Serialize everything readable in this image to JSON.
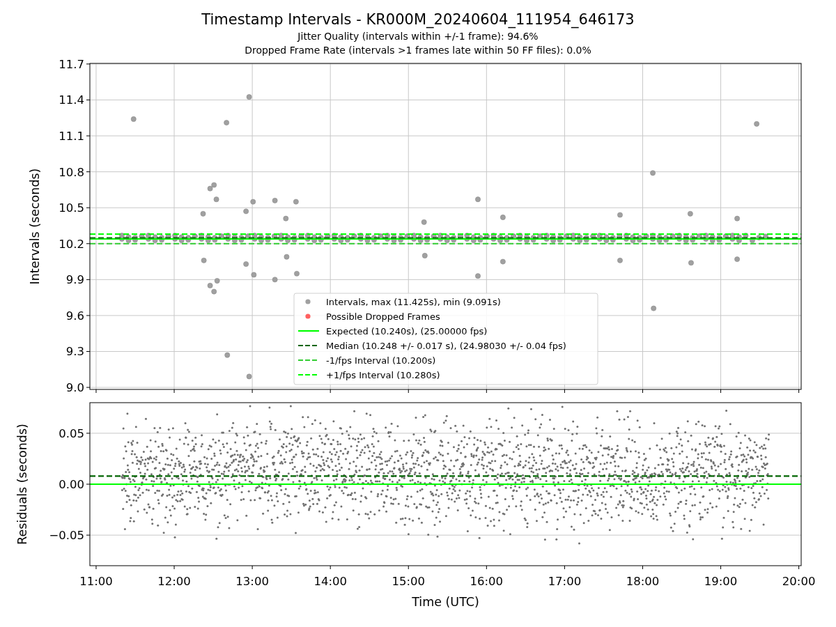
{
  "title": "Timestamp Intervals - KR000M_20240604_111954_646173",
  "subtitles": [
    "Jitter Quality (intervals within +/-1 frame): 94.6%",
    "Dropped Frame Rate (intervals >1 frames late within 50 FF files): 0.0%"
  ],
  "charts": [
    {
      "chart_data": {
        "type": "scatter",
        "ylabel": "Intervals (seconds)",
        "grid": true,
        "legend": "lower center",
        "xlim": [
          10.92,
          20.03
        ],
        "ylim": [
          8.983,
          11.705
        ],
        "yticks": [
          {
            "value": 9.0,
            "label": "9.0"
          },
          {
            "value": 9.3,
            "label": "9.3"
          },
          {
            "value": 9.6,
            "label": "9.6"
          },
          {
            "value": 9.9,
            "label": "9.9"
          },
          {
            "value": 10.2,
            "label": "10.2"
          },
          {
            "value": 10.5,
            "label": "10.5"
          },
          {
            "value": 10.8,
            "label": "10.8"
          },
          {
            "value": 11.1,
            "label": "11.1"
          },
          {
            "value": 11.4,
            "label": "11.4"
          },
          {
            "value": 11.7,
            "label": "11.7"
          }
        ],
        "series": [
          {
            "name": "Intervals, max (11.425s), min (9.091s)",
            "color": "#a0a0a0",
            "x": [
              11.48,
              12.67,
              12.96,
              19.46,
              18.13,
              12.46,
              12.51,
              12.54,
              12.37,
              12.92,
              13.01,
              13.29,
              13.56,
              13.43,
              15.2,
              15.89,
              16.21,
              17.71,
              18.61,
              19.21,
              12.38,
              12.46,
              12.51,
              12.55,
              12.92,
              13.02,
              13.29,
              13.44,
              13.57,
              15.21,
              15.89,
              16.21,
              17.71,
              18.62,
              19.21,
              18.14,
              12.68,
              12.96,
              11.33,
              11.415,
              11.5,
              11.585,
              11.67,
              11.755,
              11.84,
              11.925,
              12.01,
              12.095,
              12.18,
              12.265,
              12.35,
              12.435,
              12.52,
              12.605,
              12.69,
              12.775,
              12.86,
              12.945,
              13.03,
              13.115,
              13.2,
              13.285,
              13.37,
              13.455,
              13.54,
              13.625,
              13.71,
              13.795,
              13.88,
              13.965,
              14.05,
              14.135,
              14.22,
              14.305,
              14.39,
              14.475,
              14.56,
              14.645,
              14.73,
              14.815,
              14.9,
              14.985,
              15.07,
              15.155,
              15.24,
              15.325,
              15.41,
              15.495,
              15.58,
              15.665,
              15.75,
              15.835,
              15.92,
              16.005,
              16.09,
              16.175,
              16.26,
              16.345,
              16.43,
              16.515,
              16.6,
              16.685,
              16.77,
              16.855,
              16.94,
              17.025,
              17.11,
              17.195,
              17.28,
              17.365,
              17.45,
              17.535,
              17.62,
              17.705,
              17.79,
              17.875,
              17.96,
              18.045,
              18.13,
              18.215,
              18.3,
              18.385,
              18.47,
              18.555,
              18.64,
              18.725,
              18.81,
              18.895,
              18.98,
              19.065,
              19.15,
              19.235,
              19.32,
              19.405,
              19.49,
              19.575,
              11.33,
              11.415,
              11.5,
              11.585,
              11.67,
              11.755,
              11.84,
              11.925,
              12.01,
              12.095,
              12.18,
              12.265,
              12.35,
              12.435,
              12.52,
              12.605,
              12.69,
              12.775,
              12.86,
              12.945,
              13.03,
              13.115,
              13.2,
              13.285,
              13.37,
              13.455,
              13.54,
              13.625,
              13.71,
              13.795,
              13.88,
              13.965,
              14.05,
              14.135,
              14.22,
              14.305,
              14.39,
              14.475,
              14.56,
              14.645,
              14.73,
              14.815,
              14.9,
              14.985,
              15.07,
              15.155,
              15.24,
              15.325,
              15.41,
              15.495,
              15.58,
              15.665,
              15.75,
              15.835,
              15.92,
              16.005,
              16.09,
              16.175,
              16.26,
              16.345,
              16.43,
              16.515,
              16.6,
              16.685,
              16.77,
              16.855,
              16.94,
              17.025,
              17.11,
              17.195,
              17.28,
              17.365,
              17.45,
              17.535,
              17.62,
              17.705,
              17.79,
              17.875,
              17.96,
              18.045,
              18.13,
              18.215,
              18.3,
              18.385,
              18.47,
              18.555,
              18.64,
              18.725,
              18.81,
              18.895,
              18.98,
              19.065,
              19.15,
              19.235
            ],
            "values": [
              11.24,
              11.21,
              11.425,
              11.2,
              10.79,
              10.66,
              10.69,
              10.57,
              10.45,
              10.47,
              10.55,
              10.56,
              10.55,
              10.41,
              10.38,
              10.57,
              10.42,
              10.44,
              10.45,
              10.41,
              10.06,
              9.85,
              9.8,
              9.89,
              10.03,
              9.94,
              9.9,
              10.09,
              9.95,
              10.1,
              9.93,
              10.05,
              10.06,
              10.04,
              10.07,
              9.66,
              9.27,
              9.091,
              10.24,
              10.255,
              10.232,
              10.262,
              10.24,
              10.255,
              10.232,
              10.262,
              10.24,
              10.255,
              10.232,
              10.262,
              10.24,
              10.255,
              10.232,
              10.262,
              10.24,
              10.255,
              10.232,
              10.262,
              10.24,
              10.255,
              10.232,
              10.262,
              10.24,
              10.255,
              10.232,
              10.262,
              10.24,
              10.255,
              10.232,
              10.262,
              10.24,
              10.255,
              10.232,
              10.262,
              10.24,
              10.255,
              10.232,
              10.262,
              10.24,
              10.255,
              10.232,
              10.262,
              10.24,
              10.255,
              10.232,
              10.262,
              10.24,
              10.255,
              10.232,
              10.262,
              10.24,
              10.255,
              10.232,
              10.262,
              10.24,
              10.255,
              10.232,
              10.262,
              10.24,
              10.255,
              10.232,
              10.262,
              10.24,
              10.255,
              10.232,
              10.262,
              10.24,
              10.255,
              10.232,
              10.262,
              10.24,
              10.255,
              10.232,
              10.262,
              10.24,
              10.255,
              10.232,
              10.262,
              10.24,
              10.255,
              10.232,
              10.262,
              10.24,
              10.255,
              10.232,
              10.262,
              10.24,
              10.255,
              10.232,
              10.262,
              10.24,
              10.255,
              10.268,
              10.228,
              10.25,
              10.26,
              10.268,
              10.228,
              10.25,
              10.26,
              10.268,
              10.228,
              10.25,
              10.26,
              10.268,
              10.228,
              10.25,
              10.26,
              10.268,
              10.228,
              10.25,
              10.26,
              10.268,
              10.228,
              10.25,
              10.26,
              10.268,
              10.228,
              10.25,
              10.26,
              10.268,
              10.228,
              10.25,
              10.26,
              10.268,
              10.228,
              10.25,
              10.26,
              10.268,
              10.228,
              10.25,
              10.26,
              10.268,
              10.228,
              10.25,
              10.26,
              10.268,
              10.228,
              10.25,
              10.26,
              10.268,
              10.228,
              10.25,
              10.26,
              10.268,
              10.228,
              10.25,
              10.26,
              10.268,
              10.228,
              10.25,
              10.26,
              10.268,
              10.228,
              10.25,
              10.26,
              10.268,
              10.228,
              10.25,
              10.26,
              10.268,
              10.228,
              10.25,
              10.26,
              10.268,
              10.228,
              10.25,
              10.26,
              10.268,
              10.228,
              10.25,
              10.26,
              10.268,
              10.228,
              10.25,
              10.26,
              10.268,
              10.228,
              10.25,
              10.26,
              10.268,
              10.228,
              10.25,
              10.26,
              10.268,
              10.228,
              10.25,
              10.26,
              10.268,
              10.228
            ]
          },
          {
            "name": "Possible Dropped Frames",
            "color": "#ff6060"
          },
          {
            "name": "Expected (10.240s), (25.00000 fps)",
            "type": "line",
            "color": "#00ff00",
            "line_style": "solid",
            "x": [
              10.92,
              20.03
            ],
            "values": [
              10.24,
              10.24
            ]
          },
          {
            "name": "Median (10.248 +/- 0.017 s), (24.98030 +/- 0.04 fps)",
            "type": "line",
            "color": "#006400",
            "line_style": "dashed",
            "x": [
              10.92,
              20.03
            ],
            "values": [
              10.248,
              10.248
            ]
          },
          {
            "name": "-1/fps Interval (10.200s)",
            "type": "line",
            "color": "#32cd32",
            "line_style": "dashed",
            "x": [
              10.92,
              20.03
            ],
            "values": [
              10.2,
              10.2
            ]
          },
          {
            "name": "+1/fps Interval (10.280s)",
            "type": "line",
            "color": "#00ff00",
            "line_style": "dashed",
            "x": [
              10.92,
              20.03
            ],
            "values": [
              10.28,
              10.28
            ]
          }
        ]
      }
    },
    {
      "chart_data": {
        "type": "line",
        "xlabel": "Time (UTC)",
        "ylabel": "Residuals (seconds)",
        "grid": true,
        "xlim": [
          10.92,
          20.03
        ],
        "ylim": [
          -0.08,
          0.08
        ],
        "xticks": [
          {
            "value": 11,
            "label": "11:00"
          },
          {
            "value": 12,
            "label": "12:00"
          },
          {
            "value": 13,
            "label": "13:00"
          },
          {
            "value": 14,
            "label": "14:00"
          },
          {
            "value": 15,
            "label": "15:00"
          },
          {
            "value": 16,
            "label": "16:00"
          },
          {
            "value": 17,
            "label": "17:00"
          },
          {
            "value": 18,
            "label": "18:00"
          },
          {
            "value": 19,
            "label": "19:00"
          },
          {
            "value": 20,
            "label": "20:00"
          }
        ],
        "yticks": [
          {
            "value": -0.05,
            "label": "−0.05"
          },
          {
            "value": 0,
            "label": "0.00"
          },
          {
            "value": 0.05,
            "label": "0.05"
          }
        ],
        "x": [
          10.92,
          20.03
        ],
        "series": [
          {
            "color": "#00ff00",
            "line_style": "solid",
            "values": [
              0,
              0
            ]
          },
          {
            "color": "#006400",
            "line_style": "dashed",
            "values": [
              0.008,
              0.008
            ]
          }
        ]
      }
    }
  ]
}
